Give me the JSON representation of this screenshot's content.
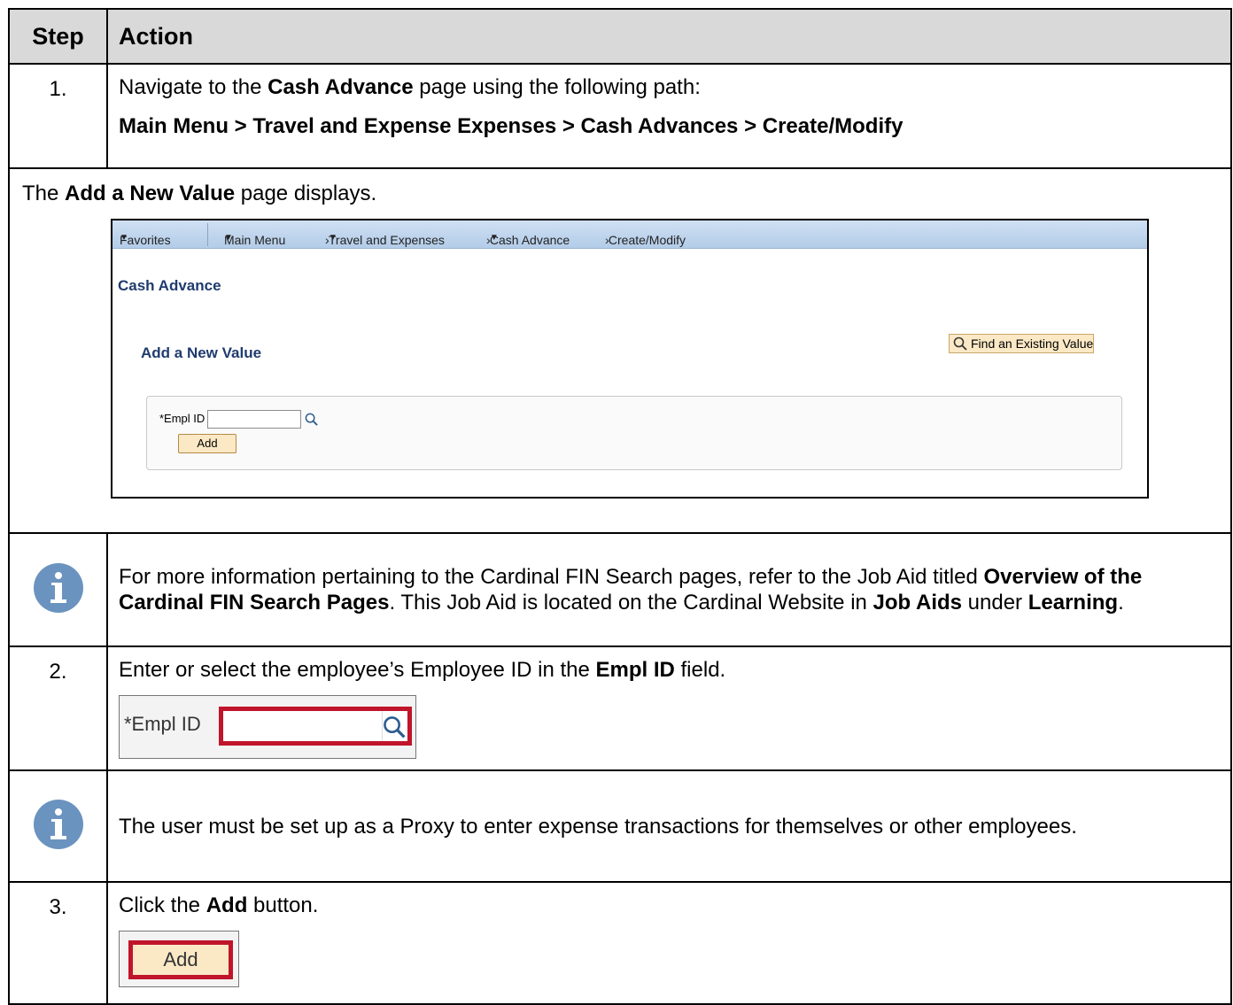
{
  "header": {
    "step": "Step",
    "action": "Action"
  },
  "step1": {
    "number": "1.",
    "text_prefix": "Navigate to the ",
    "text_bold": "Cash Advance",
    "text_suffix": " page using the following path:",
    "path": "Main Menu > Travel and Expense Expenses > Cash Advances > Create/Modify"
  },
  "displays": {
    "prefix": "The ",
    "bold": "Add a New Value",
    "suffix": " page displays."
  },
  "screenshot": {
    "nav": {
      "favorites": "Favorites",
      "main_menu": "Main Menu",
      "travel": "Travel and Expenses",
      "cash_advance": "Cash Advance",
      "create_modify": "Create/Modify"
    },
    "page_title": "Cash Advance",
    "subtitle": "Add a New Value",
    "find_button": "Find an Existing Value",
    "empl_label": "*Empl ID",
    "add_button": "Add"
  },
  "note1": {
    "t1": "For more information pertaining to the Cardinal FIN Search pages, refer to the Job Aid titled ",
    "b1": "Overview of the Cardinal FIN Search Pages",
    "t2": ".  This Job Aid is located on the Cardinal Website in ",
    "b2": "Job Aids",
    "t3": " under ",
    "b3": "Learning",
    "t4": "."
  },
  "step2": {
    "number": "2.",
    "text_prefix": "Enter or select the employee’s Employee ID in the ",
    "text_bold": "Empl ID",
    "text_suffix": " field.",
    "crop_label": "*Empl ID"
  },
  "note2": {
    "text": "The user must be set up as a Proxy to enter expense transactions for themselves or other employees."
  },
  "step3": {
    "number": "3.",
    "text_prefix": "Click the ",
    "text_bold": "Add",
    "text_suffix": " button.",
    "crop_button": "Add"
  },
  "colors": {
    "info_icon": "#6b93bf",
    "highlight": "#c0152b",
    "ps_button": "#fbe9c6",
    "ps_navbar": "#c4d8ee"
  }
}
